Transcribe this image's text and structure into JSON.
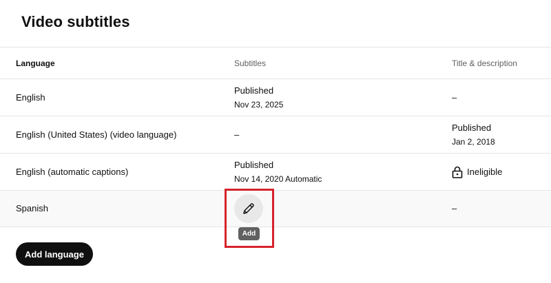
{
  "page": {
    "title": "Video subtitles"
  },
  "table": {
    "headers": {
      "language": "Language",
      "subtitles": "Subtitles",
      "title_description": "Title & description"
    },
    "rows": [
      {
        "language": "English",
        "subtitles": {
          "status": "Published",
          "date": "Nov 23, 2025"
        },
        "title_description": {
          "status": "–"
        }
      },
      {
        "language": "English (United States) (video language)",
        "subtitles": {
          "status": "–"
        },
        "title_description": {
          "status": "Published",
          "date": "Jan 2, 2018"
        }
      },
      {
        "language": "English (automatic captions)",
        "subtitles": {
          "status": "Published",
          "date": "Nov 14, 2020 Automatic"
        },
        "title_description": {
          "status": "Ineligible",
          "icon": "lock-icon"
        }
      },
      {
        "language": "Spanish",
        "subtitles": {
          "action_icon": "pencil-icon",
          "tooltip": "Add"
        },
        "title_description": {
          "status": "–"
        }
      }
    ]
  },
  "actions": {
    "add_language_label": "Add language"
  },
  "colors": {
    "highlight_border": "#d6232c",
    "primary_button": "#0f0f0f",
    "row_hover": "#f9f9f9"
  }
}
